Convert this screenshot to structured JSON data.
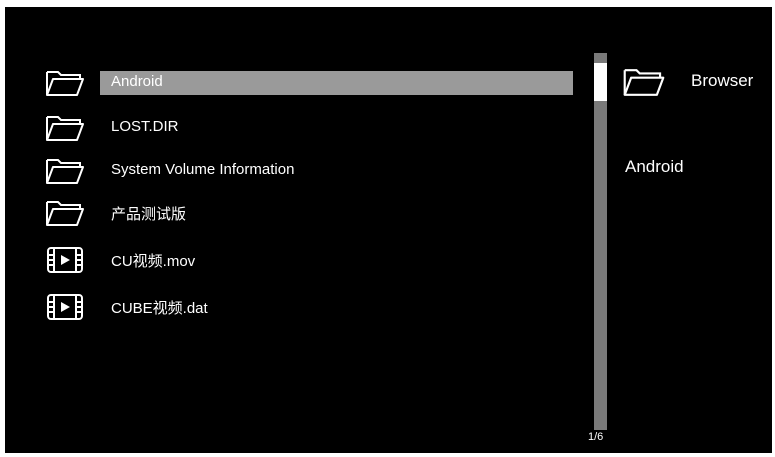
{
  "file_list": {
    "items": [
      {
        "name": "Android",
        "type": "folder",
        "icon": "folder-icon",
        "selected": true
      },
      {
        "name": "LOST.DIR",
        "type": "folder",
        "icon": "folder-icon",
        "selected": false
      },
      {
        "name": "System Volume Information",
        "type": "folder",
        "icon": "folder-icon",
        "selected": false
      },
      {
        "name": "产品测试版",
        "type": "folder",
        "icon": "folder-icon",
        "selected": false
      },
      {
        "name": "CU视频.mov",
        "type": "video",
        "icon": "video-file-icon",
        "selected": false
      },
      {
        "name": "CUBE视频.dat",
        "type": "video",
        "icon": "video-file-icon",
        "selected": false
      }
    ],
    "page_indicator": "1/6"
  },
  "preview": {
    "title": "Browser",
    "icon": "folder-icon",
    "selected_name": "Android"
  },
  "colors": {
    "background": "#000000",
    "text": "#ffffff",
    "selection": "#9a9a9a",
    "scrollbar_track": "#7a7a7a",
    "scrollbar_thumb": "#ffffff"
  }
}
